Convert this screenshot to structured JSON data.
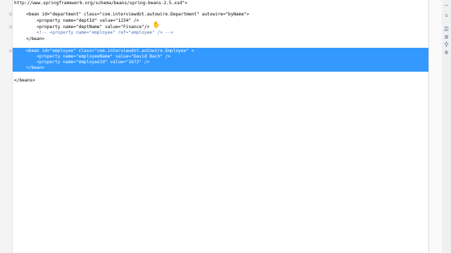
{
  "editor": {
    "lines": [
      {
        "text": "http://www.springframework.org/schema/beans/spring-beans-2.5.xsd\">"
      },
      {
        "text": "<bean id=\"department\" class=\"com.interviewdot.autowire.Department\" autowire=\"byName\">"
      },
      {
        "text": "<property name=\"deptId\" value=\"1234\" />"
      },
      {
        "text": "<property name=\"deptName\" value=\"Finance\"/>"
      },
      {
        "text": "<!-- <property name=\"employee\" ref=\"employee\" /> -->"
      },
      {
        "text": "</bean>"
      },
      {
        "text": "<bean id=\"employee\" class=\"com.interviewdot.autowire.Employee\" >"
      },
      {
        "text": "<property name=\"employeeName\" value=\"David Bach\" />"
      },
      {
        "text": "<property name=\"employeeId\" value=\"1672\" />"
      },
      {
        "text": "</bean>"
      },
      {
        "text": "</beans>"
      }
    ]
  },
  "fold_markers": [
    "⊟",
    "⊟",
    "⊟"
  ],
  "toolbar": {
    "icons": [
      "minimize-icon",
      "maximize-icon",
      "outline-icon",
      "hierarchy-icon",
      "link-icon",
      "settings-icon"
    ],
    "glyphs": [
      "—",
      "▫",
      "☰",
      "⊞",
      "⚲",
      "⚙"
    ]
  },
  "colors": {
    "selection": "#3399ff",
    "tag": "#3f7f7f",
    "attribute": "#7f007f",
    "value": "#2a00ff",
    "comment": "#4a6fb8"
  }
}
